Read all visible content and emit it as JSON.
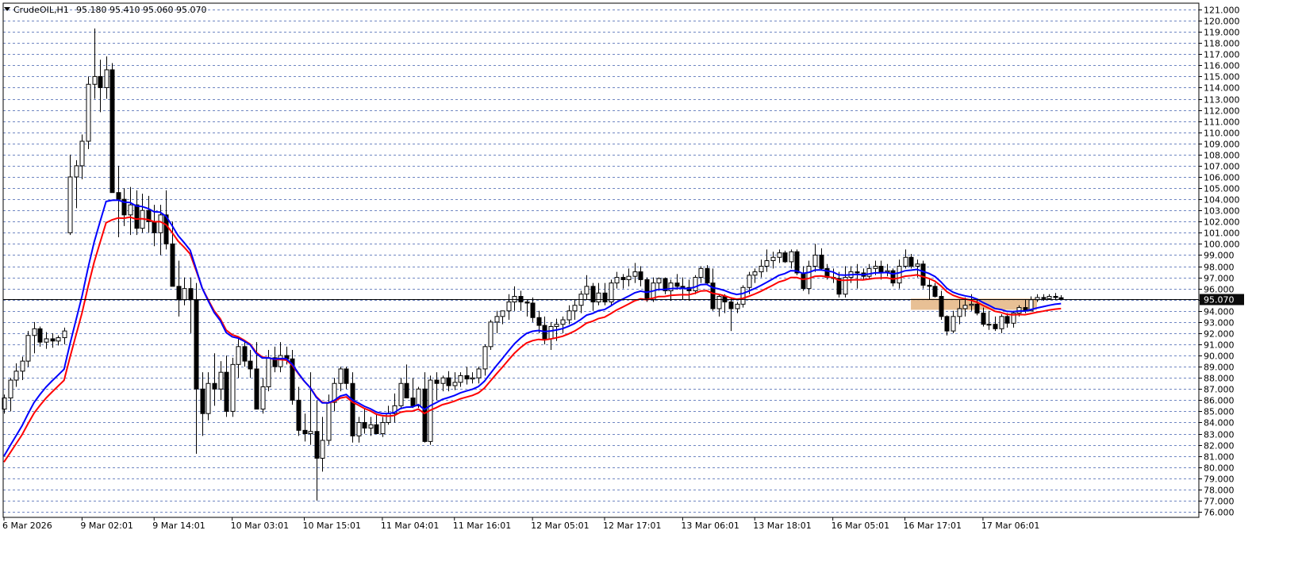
{
  "chart_data": {
    "type": "candlestick",
    "symbol": "CrudeOIL",
    "timeframe": "H1",
    "header_ohlc": "95.180 95.410 95.060 95.070",
    "current_price": "95.070",
    "ylim": [
      76,
      121
    ],
    "y_ticks": [
      "121.000",
      "120.000",
      "119.000",
      "118.000",
      "117.000",
      "116.000",
      "115.000",
      "114.000",
      "113.000",
      "112.000",
      "111.000",
      "110.000",
      "109.000",
      "108.000",
      "107.000",
      "106.000",
      "105.000",
      "104.000",
      "103.000",
      "102.000",
      "101.000",
      "100.000",
      "99.000",
      "98.000",
      "97.000",
      "96.000",
      "95.000",
      "94.000",
      "93.000",
      "92.000",
      "91.000",
      "90.000",
      "89.000",
      "88.000",
      "87.000",
      "86.000",
      "85.000",
      "84.000",
      "83.000",
      "82.000",
      "81.000",
      "80.000",
      "79.000",
      "78.000",
      "77.000",
      "76.000"
    ],
    "x_ticks": [
      {
        "label": "6 Mar 2026",
        "i": 0
      },
      {
        "label": "9 Mar 02:01",
        "i": 13
      },
      {
        "label": "9 Mar 14:01",
        "i": 25
      },
      {
        "label": "10 Mar 03:01",
        "i": 38
      },
      {
        "label": "10 Mar 15:01",
        "i": 50
      },
      {
        "label": "11 Mar 04:01",
        "i": 63
      },
      {
        "label": "11 Mar 16:01",
        "i": 75
      },
      {
        "label": "12 Mar 05:01",
        "i": 88
      },
      {
        "label": "12 Mar 17:01",
        "i": 100
      },
      {
        "label": "13 Mar 06:01",
        "i": 113
      },
      {
        "label": "13 Mar 18:01",
        "i": 125
      },
      {
        "label": "16 Mar 05:01",
        "i": 138
      },
      {
        "label": "16 Mar 17:01",
        "i": 150
      },
      {
        "label": "17 Mar 06:01",
        "i": 163
      }
    ],
    "candles": [
      [
        85.2,
        86.5,
        84.8,
        86.2
      ],
      [
        86.2,
        88.0,
        85.0,
        87.8
      ],
      [
        87.8,
        89.3,
        87.2,
        88.6
      ],
      [
        88.6,
        89.9,
        87.8,
        89.5
      ],
      [
        89.5,
        92.2,
        89.0,
        91.8
      ],
      [
        91.8,
        93.0,
        90.2,
        92.4
      ],
      [
        92.4,
        92.6,
        90.8,
        91.2
      ],
      [
        91.2,
        92.1,
        90.6,
        91.5
      ],
      [
        91.5,
        92.0,
        90.7,
        91.3
      ],
      [
        91.3,
        91.8,
        90.9,
        91.6
      ],
      [
        91.6,
        92.5,
        91.0,
        92.2
      ],
      [
        101.0,
        108.0,
        100.8,
        106.0
      ],
      [
        106.0,
        107.5,
        103.2,
        107.0
      ],
      [
        107.0,
        109.8,
        105.8,
        109.2
      ],
      [
        109.2,
        115.0,
        108.5,
        114.3
      ],
      [
        114.3,
        119.3,
        113.0,
        115.0
      ],
      [
        115.0,
        116.5,
        111.8,
        114.0
      ],
      [
        114.0,
        116.8,
        113.0,
        115.6
      ],
      [
        115.6,
        116.2,
        104.6,
        104.6
      ],
      [
        104.6,
        107.0,
        100.6,
        104.0
      ],
      [
        104.0,
        105.0,
        101.6,
        102.6
      ],
      [
        102.6,
        105.1,
        100.8,
        103.5
      ],
      [
        103.5,
        104.8,
        100.8,
        101.4
      ],
      [
        101.4,
        104.5,
        101.0,
        103.0
      ],
      [
        103.0,
        104.3,
        101.0,
        102.0
      ],
      [
        102.0,
        103.5,
        99.8,
        101.0
      ],
      [
        101.0,
        103.5,
        99.0,
        102.6
      ],
      [
        102.6,
        104.8,
        99.5,
        100.0
      ],
      [
        100.0,
        102.0,
        96.2,
        96.2
      ],
      [
        96.2,
        98.5,
        93.5,
        95.0
      ],
      [
        95.0,
        97.0,
        94.5,
        96.0
      ],
      [
        96.0,
        97.0,
        92.0,
        95.0
      ],
      [
        95.0,
        96.5,
        81.2,
        87.0
      ],
      [
        87.0,
        88.5,
        82.8,
        84.8
      ],
      [
        84.8,
        88.5,
        84.2,
        87.5
      ],
      [
        87.5,
        90.2,
        85.5,
        87.0
      ],
      [
        87.0,
        89.5,
        86.0,
        88.5
      ],
      [
        88.5,
        90.0,
        84.5,
        85.0
      ],
      [
        85.0,
        89.8,
        84.5,
        89.2
      ],
      [
        89.2,
        91.5,
        88.0,
        90.8
      ],
      [
        90.8,
        91.3,
        89.0,
        89.5
      ],
      [
        89.5,
        90.5,
        88.0,
        88.8
      ],
      [
        88.8,
        91.2,
        85.2,
        85.2
      ],
      [
        85.2,
        88.0,
        84.8,
        87.2
      ],
      [
        87.2,
        90.5,
        86.8,
        89.8
      ],
      [
        89.8,
        90.8,
        88.5,
        89.0
      ],
      [
        89.0,
        91.2,
        88.5,
        90.0
      ],
      [
        90.0,
        90.8,
        89.2,
        89.7
      ],
      [
        89.7,
        90.5,
        85.6,
        86.0
      ],
      [
        86.0,
        87.2,
        82.8,
        83.3
      ],
      [
        83.3,
        84.8,
        82.3,
        83.0
      ],
      [
        83.0,
        88.5,
        82.0,
        83.2
      ],
      [
        83.2,
        86.0,
        77.0,
        80.8
      ],
      [
        80.8,
        84.5,
        79.6,
        82.4
      ],
      [
        82.4,
        86.5,
        82.0,
        85.8
      ],
      [
        85.8,
        88.0,
        85.0,
        87.5
      ],
      [
        87.5,
        89.0,
        86.8,
        88.8
      ],
      [
        88.8,
        89.0,
        87.0,
        87.5
      ],
      [
        87.5,
        88.5,
        82.2,
        82.8
      ],
      [
        82.8,
        84.5,
        82.2,
        84.0
      ],
      [
        84.0,
        85.2,
        83.0,
        83.5
      ],
      [
        83.5,
        84.5,
        82.8,
        83.8
      ],
      [
        83.8,
        84.8,
        83.0,
        83.0
      ],
      [
        83.0,
        84.5,
        82.7,
        84.0
      ],
      [
        84.0,
        85.5,
        83.8,
        84.8
      ],
      [
        84.8,
        86.6,
        84.0,
        85.5
      ],
      [
        85.5,
        88.0,
        85.2,
        87.5
      ],
      [
        87.5,
        89.2,
        86.2,
        86.2
      ],
      [
        86.2,
        88.0,
        85.3,
        85.5
      ],
      [
        85.5,
        87.2,
        85.3,
        87.0
      ],
      [
        87.0,
        88.5,
        82.2,
        82.3
      ],
      [
        82.3,
        88.2,
        82.0,
        87.8
      ],
      [
        87.8,
        88.5,
        86.0,
        87.5
      ],
      [
        87.5,
        88.2,
        86.8,
        88.0
      ],
      [
        88.0,
        88.6,
        86.8,
        87.3
      ],
      [
        87.3,
        88.5,
        86.9,
        87.6
      ],
      [
        87.6,
        88.5,
        87.2,
        88.2
      ],
      [
        88.2,
        89.0,
        87.4,
        87.9
      ],
      [
        87.9,
        88.5,
        87.5,
        88.0
      ],
      [
        88.0,
        89.0,
        87.5,
        88.8
      ],
      [
        88.8,
        91.0,
        88.2,
        90.8
      ],
      [
        90.8,
        93.2,
        90.5,
        93.0
      ],
      [
        93.0,
        94.0,
        92.0,
        93.5
      ],
      [
        93.5,
        94.0,
        92.8,
        94.0
      ],
      [
        94.0,
        95.5,
        93.2,
        94.8
      ],
      [
        94.8,
        96.2,
        94.0,
        95.3
      ],
      [
        95.3,
        95.8,
        94.0,
        94.8
      ],
      [
        94.8,
        95.0,
        93.5,
        94.7
      ],
      [
        94.7,
        95.2,
        93.0,
        93.4
      ],
      [
        93.4,
        94.0,
        92.0,
        92.7
      ],
      [
        92.7,
        93.5,
        91.0,
        91.5
      ],
      [
        91.5,
        93.0,
        90.5,
        92.6
      ],
      [
        92.6,
        93.3,
        91.3,
        92.8
      ],
      [
        92.8,
        93.5,
        92.0,
        93.2
      ],
      [
        93.2,
        94.5,
        92.8,
        94.0
      ],
      [
        94.0,
        95.0,
        93.2,
        94.5
      ],
      [
        94.5,
        95.8,
        93.8,
        95.5
      ],
      [
        95.5,
        97.2,
        95.0,
        96.2
      ],
      [
        96.2,
        96.5,
        94.0,
        94.8
      ],
      [
        94.8,
        96.5,
        94.5,
        95.6
      ],
      [
        95.6,
        96.5,
        94.5,
        94.8
      ],
      [
        94.8,
        96.8,
        94.5,
        96.5
      ],
      [
        96.5,
        97.5,
        96.0,
        97.0
      ],
      [
        97.0,
        97.3,
        96.0,
        96.8
      ],
      [
        96.8,
        97.8,
        96.2,
        97.1
      ],
      [
        97.1,
        98.3,
        96.5,
        97.5
      ],
      [
        97.5,
        98.0,
        96.2,
        96.8
      ],
      [
        96.8,
        97.0,
        94.8,
        95.0
      ],
      [
        95.0,
        97.0,
        94.8,
        96.5
      ],
      [
        96.5,
        97.0,
        95.8,
        96.9
      ],
      [
        96.9,
        97.0,
        95.5,
        95.8
      ],
      [
        95.8,
        96.8,
        94.9,
        96.5
      ],
      [
        96.5,
        97.3,
        95.9,
        96.2
      ],
      [
        96.2,
        97.0,
        95.0,
        96.1
      ],
      [
        96.1,
        96.8,
        94.9,
        95.8
      ],
      [
        95.8,
        97.2,
        95.5,
        97.0
      ],
      [
        97.0,
        98.0,
        96.5,
        97.8
      ],
      [
        97.8,
        98.1,
        96.3,
        96.5
      ],
      [
        96.5,
        97.8,
        94.0,
        94.2
      ],
      [
        94.2,
        95.5,
        93.5,
        95.3
      ],
      [
        95.3,
        95.5,
        93.8,
        94.8
      ],
      [
        94.8,
        95.2,
        92.2,
        94.2
      ],
      [
        94.2,
        94.8,
        93.8,
        94.6
      ],
      [
        94.6,
        96.3,
        94.3,
        96.1
      ],
      [
        96.1,
        97.5,
        95.5,
        97.2
      ],
      [
        97.2,
        97.8,
        96.5,
        97.5
      ],
      [
        97.5,
        98.6,
        97.0,
        98.0
      ],
      [
        98.0,
        99.5,
        97.5,
        98.5
      ],
      [
        98.5,
        99.3,
        97.8,
        98.8
      ],
      [
        98.8,
        99.5,
        98.3,
        99.2
      ],
      [
        99.2,
        99.4,
        98.3,
        98.4
      ],
      [
        98.4,
        99.5,
        97.8,
        99.3
      ],
      [
        99.3,
        99.5,
        97.2,
        97.4
      ],
      [
        97.4,
        98.0,
        95.8,
        96.0
      ],
      [
        96.0,
        98.5,
        95.5,
        98.0
      ],
      [
        98.0,
        100.0,
        97.5,
        99.0
      ],
      [
        99.0,
        99.6,
        97.6,
        97.8
      ],
      [
        97.8,
        98.2,
        96.8,
        97.0
      ],
      [
        97.0,
        97.8,
        96.5,
        96.9
      ],
      [
        96.9,
        97.5,
        95.2,
        95.5
      ],
      [
        95.5,
        98.0,
        95.2,
        97.0
      ],
      [
        97.0,
        98.0,
        96.5,
        97.5
      ],
      [
        97.5,
        98.2,
        96.0,
        97.4
      ],
      [
        97.4,
        97.8,
        96.8,
        97.1
      ],
      [
        97.1,
        98.2,
        96.8,
        97.8
      ],
      [
        97.8,
        98.5,
        97.2,
        98.0
      ],
      [
        98.0,
        98.5,
        96.8,
        97.5
      ],
      [
        97.5,
        98.2,
        97.1,
        97.6
      ],
      [
        97.6,
        97.8,
        96.2,
        96.5
      ],
      [
        96.5,
        98.6,
        96.0,
        98.0
      ],
      [
        98.0,
        99.5,
        97.8,
        98.8
      ],
      [
        98.8,
        99.1,
        97.8,
        98.0
      ],
      [
        98.0,
        98.6,
        97.0,
        98.2
      ],
      [
        98.2,
        98.5,
        96.0,
        96.3
      ],
      [
        96.3,
        96.8,
        95.0,
        96.2
      ],
      [
        96.2,
        96.5,
        95.2,
        95.3
      ],
      [
        95.3,
        95.8,
        93.2,
        93.5
      ],
      [
        93.5,
        93.6,
        91.8,
        92.2
      ],
      [
        92.2,
        94.0,
        92.0,
        93.5
      ],
      [
        93.5,
        95.0,
        92.8,
        94.2
      ],
      [
        94.2,
        95.2,
        93.5,
        94.5
      ],
      [
        94.5,
        95.5,
        94.0,
        94.6
      ],
      [
        94.6,
        95.0,
        93.6,
        93.8
      ],
      [
        93.8,
        94.3,
        92.6,
        92.8
      ],
      [
        92.8,
        94.0,
        92.3,
        92.8
      ],
      [
        92.8,
        93.5,
        92.2,
        92.4
      ],
      [
        92.4,
        93.7,
        92.0,
        93.5
      ],
      [
        93.5,
        93.8,
        92.5,
        92.9
      ],
      [
        92.9,
        94.0,
        92.5,
        93.8
      ],
      [
        93.8,
        94.5,
        93.5,
        94.3
      ],
      [
        94.3,
        95.0,
        93.8,
        94.0
      ],
      [
        94.0,
        95.3,
        94.0,
        95.0
      ],
      [
        95.0,
        95.5,
        94.8,
        95.2
      ],
      [
        95.2,
        95.5,
        94.9,
        95.1
      ],
      [
        95.1,
        95.5,
        95.0,
        95.3
      ],
      [
        95.3,
        95.6,
        95.0,
        95.2
      ],
      [
        95.18,
        95.41,
        95.06,
        95.07
      ]
    ],
    "ma_blue": {
      "color": "#0000ff"
    },
    "ma_red": {
      "color": "#ff0000"
    },
    "zone": {
      "x_start_i": 151,
      "x_end_i": 172,
      "y_low": 94.1,
      "y_high": 95.1,
      "color": "#e6b98a"
    },
    "colors": {
      "grid": "#6f86c2",
      "bull": "#ffffff",
      "bear": "#000000",
      "current_price_bg": "#0b0b0b"
    }
  }
}
